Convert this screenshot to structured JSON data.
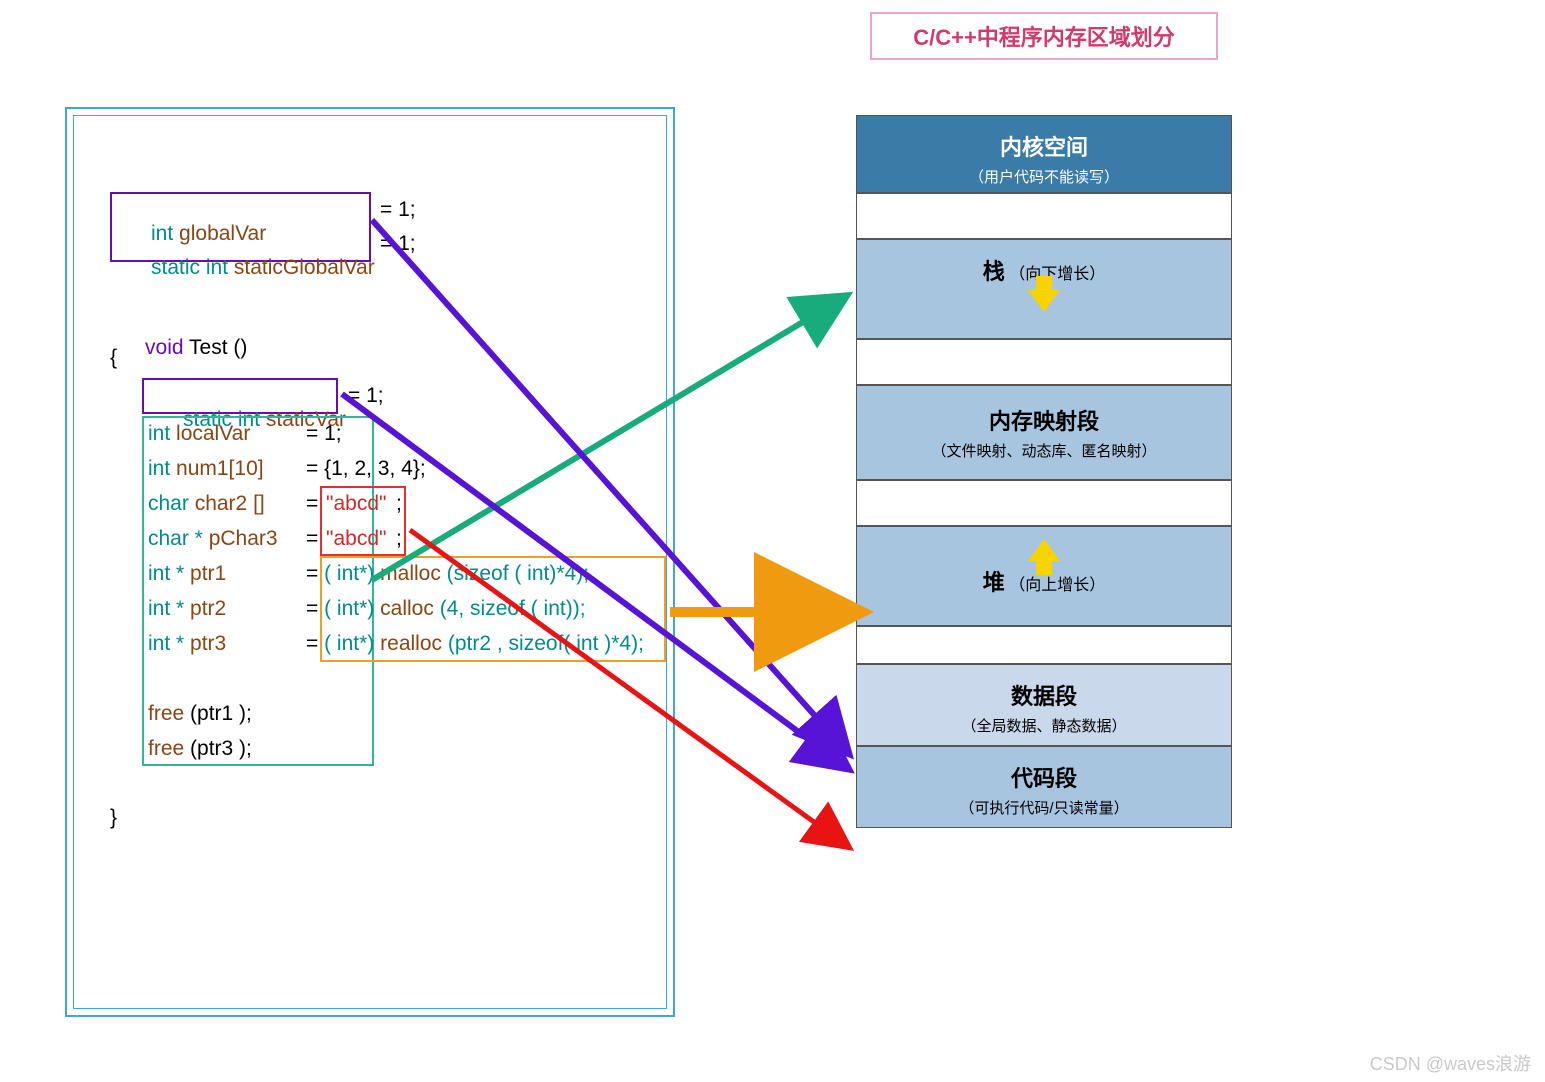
{
  "title": "C/C++中程序内存区域划分",
  "code": {
    "global": {
      "decl": "int",
      "name": "globalVar",
      "assign": "= 1;"
    },
    "staticGlobal": {
      "decl": "static int",
      "name": "staticGlobalVar",
      "assign": "= 1;"
    },
    "func": {
      "ret": "void",
      "name": "Test ()"
    },
    "open": "{",
    "close": "}",
    "staticLocal": {
      "decl": "static int",
      "name": "staticVar",
      "assign": "= 1;"
    },
    "localVar": {
      "decl": "int",
      "name": "localVar",
      "assign": "= 1;"
    },
    "num1": {
      "decl": "int",
      "name": "num1[10]",
      "assign": "= {1, 2, 3, 4};"
    },
    "char2": {
      "decl": "char",
      "name": "char2 []",
      "assign": "=",
      "literal": "\"abcd\"",
      "semi": ";"
    },
    "pChar3": {
      "decl": "char *",
      "name": "pChar3",
      "assign": "=",
      "literal": "\"abcd\"",
      "semi": ";"
    },
    "ptr1": {
      "decl": "int *",
      "name": "ptr1",
      "eq": "=",
      "cast": "( int*)",
      "fn": "malloc",
      "args": "(sizeof ( int)*4);"
    },
    "ptr2": {
      "decl": "int *",
      "name": "ptr2",
      "eq": "=",
      "cast": "( int*)",
      "fn": "calloc",
      "args": "(4, sizeof ( int));"
    },
    "ptr3": {
      "decl": "int *",
      "name": "ptr3",
      "eq": "=",
      "cast": "( int*)",
      "fn": "realloc",
      "args": "(ptr2 , sizeof( int )*4);"
    },
    "free1": {
      "fn": "free",
      "args": "(ptr1 );"
    },
    "free3": {
      "fn": "free",
      "args": "(ptr3 );"
    }
  },
  "memory": {
    "kernel": {
      "title": "内核空间",
      "sub": "（用户代码不能读写）"
    },
    "stack": {
      "title": "栈",
      "sub": "（向下增长）"
    },
    "mmap": {
      "title": "内存映射段",
      "sub": "（文件映射、动态库、匿名映射）"
    },
    "heap": {
      "title": "堆",
      "sub": "（向上增长）"
    },
    "data": {
      "title": "数据段",
      "sub": "（全局数据、静态数据）"
    },
    "codeSeg": {
      "title": "代码段",
      "sub": "（可执行代码/只读常量）"
    }
  },
  "watermark": "CSDN @waves浪游"
}
